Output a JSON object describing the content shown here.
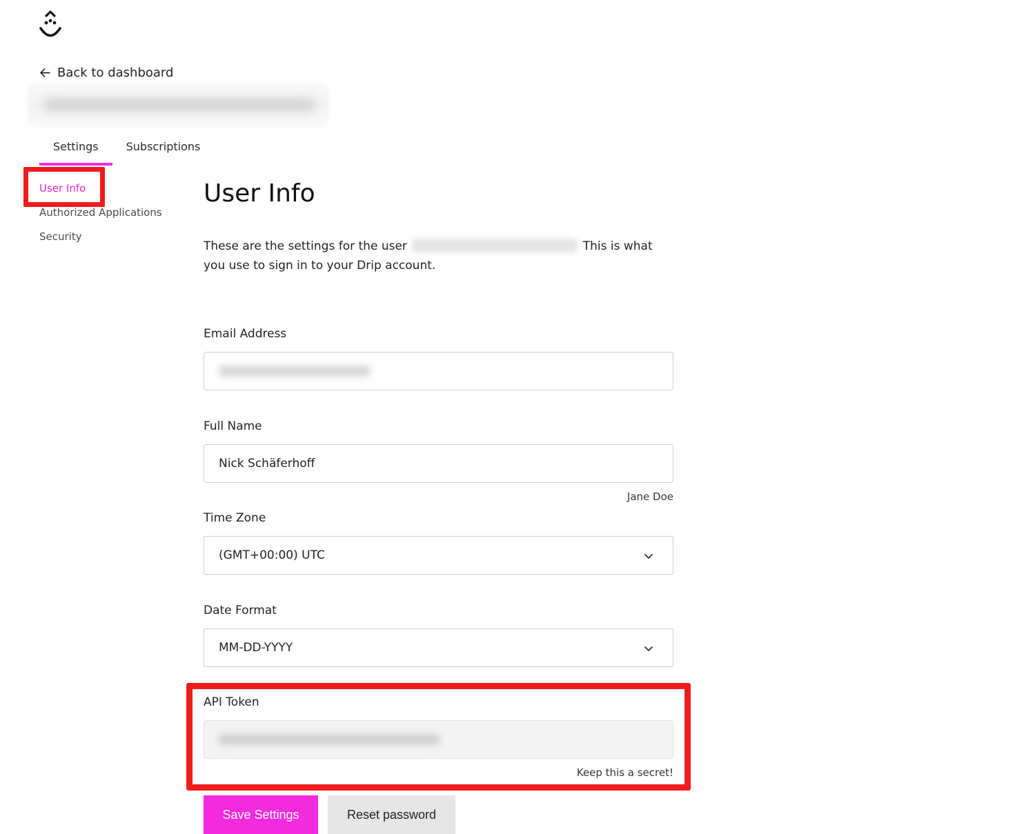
{
  "nav": {
    "back_label": "Back to dashboard"
  },
  "tabs": [
    {
      "label": "Settings",
      "active": true
    },
    {
      "label": "Subscriptions",
      "active": false
    }
  ],
  "sidebar": {
    "items": [
      {
        "label": "User Info",
        "active": true
      },
      {
        "label": "Authorized Applications",
        "active": false
      },
      {
        "label": "Security",
        "active": false
      }
    ]
  },
  "main": {
    "title": "User Info",
    "intro_before": "These are the settings for the user",
    "intro_after": "This is what you use to sign in to your Drip account."
  },
  "form": {
    "email": {
      "label": "Email Address"
    },
    "full_name": {
      "label": "Full Name",
      "value": "Nick Schäferhoff",
      "helper": "Jane Doe"
    },
    "time_zone": {
      "label": "Time Zone",
      "value": "(GMT+00:00) UTC"
    },
    "date_format": {
      "label": "Date Format",
      "value": "MM-DD-YYYY"
    },
    "api_token": {
      "label": "API Token",
      "helper": "Keep this a secret!"
    }
  },
  "actions": {
    "save_label": "Save Settings",
    "reset_label": "Reset password"
  },
  "colors": {
    "accent": "#f32ae0",
    "highlight": "#ee1c1c"
  }
}
